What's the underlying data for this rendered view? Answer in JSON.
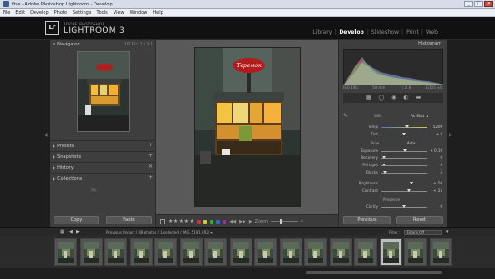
{
  "window": {
    "title": "fine - Adobe Photoshop Lightroom - Develop",
    "buttons": [
      "_",
      "□",
      "✕"
    ]
  },
  "menubar": [
    "File",
    "Edit",
    "Develop",
    "Photo",
    "Settings",
    "Tools",
    "View",
    "Window",
    "Help"
  ],
  "identity": {
    "badge": "Lr",
    "small_text": "ADOBE PHOTOSHOP",
    "product": "LIGHTROOM 3"
  },
  "modules": [
    "Library",
    "Develop",
    "Slideshow",
    "Print",
    "Web"
  ],
  "active_module": "Develop",
  "left_panel": {
    "navigator": "Navigator",
    "navigator_options": "FIT  FILL  1:1  3:1",
    "sections": [
      "Presets",
      "Snapshots",
      "History",
      "Collections"
    ],
    "copy_label": "Copy",
    "paste_label": "Paste"
  },
  "photo": {
    "sign_text": "Теремок"
  },
  "toolbar": {
    "stars": "★★★★★",
    "label_colors": [
      "#c33",
      "#cc3",
      "#3a3",
      "#36c",
      "#939"
    ],
    "zoom_label": "Zoom"
  },
  "right_panel": {
    "histogram_label": "Histogram",
    "histo_info": [
      "ISO 100",
      "50 mm",
      "f / 2.8",
      "1/125 sec"
    ],
    "tools_icons": [
      "▦",
      "◯",
      "◉",
      "◐",
      "▬"
    ],
    "wb_label": "WB :",
    "wb_value": "As Shot ↕",
    "basic_rows": [
      {
        "label": "Temp",
        "value": "5200",
        "pos": 0.55
      },
      {
        "label": "Tint",
        "value": "+ 4",
        "pos": 0.5
      },
      {
        "label": "Exposure",
        "value": "+ 0.10",
        "pos": 0.52
      },
      {
        "label": "Recovery",
        "value": "0",
        "pos": 0.05
      },
      {
        "label": "Fill Light",
        "value": "0",
        "pos": 0.05
      },
      {
        "label": "Blacks",
        "value": "5",
        "pos": 0.08
      },
      {
        "label": "Brightness",
        "value": "+ 50",
        "pos": 0.65
      },
      {
        "label": "Contrast",
        "value": "+ 25",
        "pos": 0.6
      },
      {
        "label": "Clarity",
        "value": "0",
        "pos": 0.5
      }
    ],
    "tone_label": "Tone",
    "auto_label": "Auto",
    "presence_label": "Presence",
    "previous_label": "Previous",
    "reset_label": "Reset"
  },
  "filmstrip": {
    "source": "Previous Import / 48 photos / 1 selected / IMG_5191.CR2 ▾",
    "filter_label": "Filter :",
    "filter_value": "Filters Off",
    "frame_count": 16,
    "selected_index": 13
  }
}
